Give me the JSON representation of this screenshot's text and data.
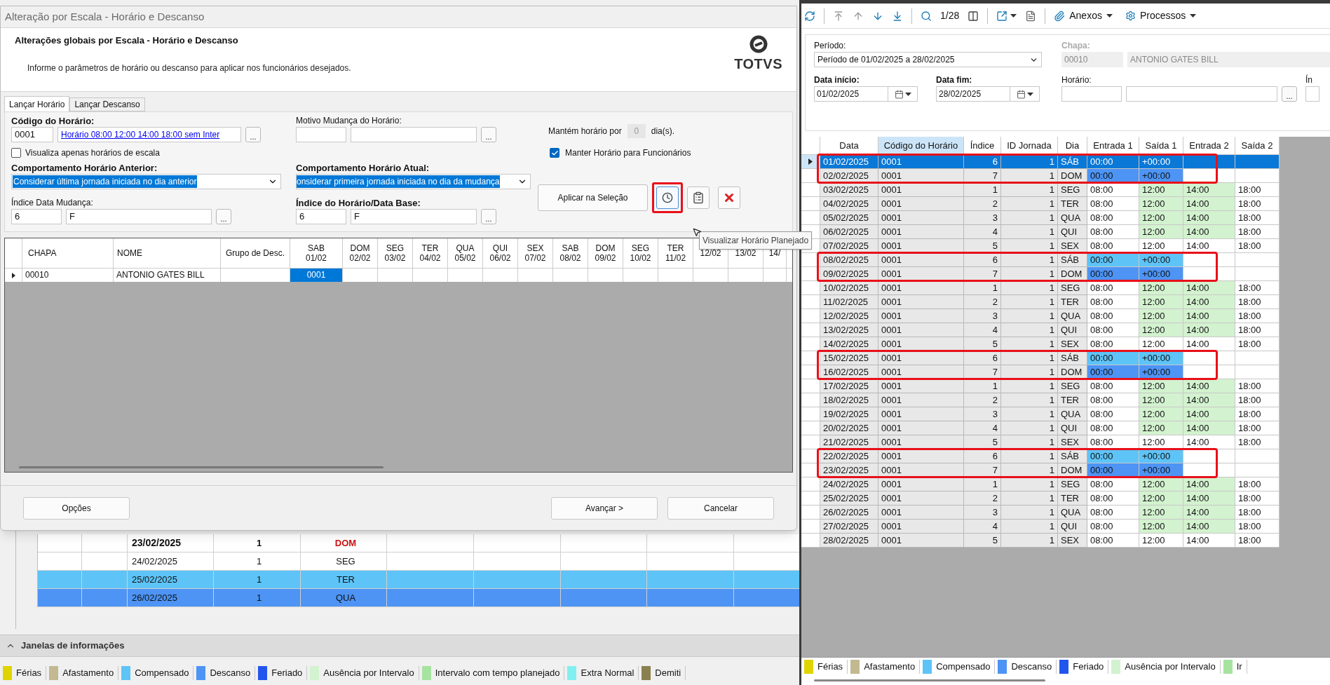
{
  "dialog": {
    "title": "Alteração por Escala - Horário e Descanso",
    "heading": "Alterações globais por Escala - Horário e Descanso",
    "description": "Informe o parâmetros de horário ou descanso para aplicar nos funcionários desejados.",
    "logo": "TOTVS",
    "tabs": [
      {
        "label": "Lançar Horário",
        "selected": true
      },
      {
        "label": "Lançar Descanso",
        "selected": false
      }
    ],
    "form": {
      "horario": {
        "label": "Código do Horário:",
        "code": "0001",
        "description": "Horário 08:00 12:00 14:00 18:00 sem Inter",
        "lookup": "..."
      },
      "only_scale": {
        "label": "Visualiza apenas horários de escala",
        "checked": false
      },
      "previous_behavior": {
        "label": "Comportamento Horário Anterior:",
        "value": "Considerar última jornada iniciada no dia anterior"
      },
      "change_index": {
        "label": "Índice Data Mudança:",
        "index": "6",
        "code": "F",
        "lookup": "..."
      },
      "reason": {
        "label": "Motivo Mudança do Horário:",
        "lookup": "..."
      },
      "current_behavior": {
        "label": "Comportamento Horário Atual:",
        "value": "onsiderar primeira jornada iniciada no dia da mudança"
      },
      "base_index": {
        "label": "Índice do Horário/Data Base:",
        "index": "6",
        "code": "F",
        "lookup": "..."
      },
      "keep_days": {
        "label": "Mantém horário por",
        "value": "0",
        "unit": "dia(s).",
        "disabled": true
      },
      "keep_schedule": {
        "label": "Manter Horário para Funcionários",
        "checked": true
      }
    },
    "actions": [
      {
        "kind": "text",
        "label": "Aplicar na Seleção"
      },
      {
        "kind": "clock",
        "highlighted": true
      },
      {
        "kind": "clipboard"
      },
      {
        "kind": "delete"
      }
    ],
    "tooltip": "Visualizar Horário Planejado",
    "grid": {
      "columns": [
        {
          "label": "CHAPA"
        },
        {
          "label": "NOME"
        },
        {
          "label": "Grupo de Desc."
        },
        {
          "day": "SAB",
          "date": "01/02"
        },
        {
          "day": "DOM",
          "date": "02/02"
        },
        {
          "day": "SEG",
          "date": "03/02"
        },
        {
          "day": "TER",
          "date": "04/02"
        },
        {
          "day": "QUA",
          "date": "05/02"
        },
        {
          "day": "QUI",
          "date": "06/02"
        },
        {
          "day": "SEX",
          "date": "07/02"
        },
        {
          "day": "SAB",
          "date": "08/02"
        },
        {
          "day": "DOM",
          "date": "09/02"
        },
        {
          "day": "SEG",
          "date": "10/02"
        },
        {
          "day": "TER",
          "date": "11/02"
        },
        {
          "date": "12/02"
        },
        {
          "date": "13/02"
        },
        {
          "date": "14/"
        }
      ],
      "rows": [
        {
          "chapa": "00010",
          "nome": "ANTONIO GATES BILL",
          "schedule": [
            {
              "value": "0001",
              "selected": true
            }
          ]
        }
      ]
    },
    "buttons": [
      "Opções",
      "Avançar >",
      "Cancelar"
    ]
  },
  "background_table": {
    "rows": [
      {
        "date": "23/02/2025",
        "jornada": "1",
        "day": "DOM",
        "sunday": true
      },
      {
        "date": "24/02/2025",
        "jornada": "1",
        "day": "SEG",
        "sunday": false
      },
      {
        "date": "25/02/2025",
        "jornada": "1",
        "day": "TER",
        "sunday": false,
        "color": "#5ec4f7"
      },
      {
        "date": "26/02/2025",
        "jornada": "1",
        "day": "QUA",
        "sunday": false,
        "color": "#4d94f5"
      }
    ]
  },
  "info_bar": {
    "title": "Janelas de informações"
  },
  "legend_left": [
    {
      "label": "Férias",
      "color": "#e0d400"
    },
    {
      "label": "Afastamento",
      "color": "#c2b990"
    },
    {
      "label": "Compensado",
      "color": "#5ec4f7"
    },
    {
      "label": "Descanso",
      "color": "#4d94f5"
    },
    {
      "label": "Feriado",
      "color": "#2255ee"
    },
    {
      "label": "Ausência por Intervalo",
      "color": "#d3f2cf"
    },
    {
      "label": "Intervalo com tempo planejado",
      "color": "#a6e3a0"
    },
    {
      "label": "Extra Normal",
      "color": "#80f0f0"
    },
    {
      "label": "Demiti",
      "color": "#8a8050"
    }
  ],
  "viewer": {
    "toolbar": {
      "counter": "1/28",
      "attachments": "Anexos",
      "processes": "Processos"
    },
    "period": {
      "label": "Período:",
      "value": "Período de 01/02/2025 a 28/02/2025"
    },
    "chapa": {
      "label": "Chapa:",
      "code": "00010",
      "name": "ANTONIO GATES BILL",
      "disabled": true
    },
    "start": {
      "label": "Data início:",
      "value": "01/02/2025"
    },
    "end": {
      "label": "Data fim:",
      "value": "28/02/2025"
    },
    "schedule": {
      "label": "Horário:",
      "lookup": "..."
    },
    "index_label": "Ín",
    "table": {
      "columns": [
        "Data",
        "Código do Horário",
        "Índice",
        "ID Jornada",
        "Dia",
        "Entrada 1",
        "Saída 1",
        "Entrada 2",
        "Saída 2"
      ],
      "rows": [
        {
          "date": "01/02/2025",
          "code": "0001",
          "index": "6",
          "jornada": "1",
          "day": "SÁB",
          "selected": true,
          "highlighted": true,
          "times": [
            {
              "value": "00:00"
            },
            {
              "value": "+00:00"
            }
          ]
        },
        {
          "date": "02/02/2025",
          "code": "0001",
          "index": "7",
          "jornada": "1",
          "day": "DOM",
          "selected": false,
          "highlighted": true,
          "times": [
            {
              "value": "00:00",
              "color": "#4d94f5"
            },
            {
              "value": "+00:00",
              "color": "#4d94f5"
            }
          ]
        },
        {
          "date": "03/02/2025",
          "code": "0001",
          "index": "1",
          "jornada": "1",
          "day": "SEG",
          "selected": false,
          "highlighted": false,
          "times": [
            {
              "value": "08:00"
            },
            {
              "value": "12:00",
              "color": "#d3f2cf"
            },
            {
              "value": "14:00",
              "color": "#d3f2cf"
            },
            {
              "value": "18:00"
            }
          ]
        },
        {
          "date": "04/02/2025",
          "code": "0001",
          "index": "2",
          "jornada": "1",
          "day": "TER",
          "selected": false,
          "highlighted": false,
          "times": [
            {
              "value": "08:00"
            },
            {
              "value": "12:00",
              "color": "#d3f2cf"
            },
            {
              "value": "14:00",
              "color": "#d3f2cf"
            },
            {
              "value": "18:00"
            }
          ]
        },
        {
          "date": "05/02/2025",
          "code": "0001",
          "index": "3",
          "jornada": "1",
          "day": "QUA",
          "selected": false,
          "highlighted": false,
          "times": [
            {
              "value": "08:00"
            },
            {
              "value": "12:00",
              "color": "#d3f2cf"
            },
            {
              "value": "14:00",
              "color": "#d3f2cf"
            },
            {
              "value": "18:00"
            }
          ]
        },
        {
          "date": "06/02/2025",
          "code": "0001",
          "index": "4",
          "jornada": "1",
          "day": "QUI",
          "selected": false,
          "highlighted": false,
          "times": [
            {
              "value": "08:00"
            },
            {
              "value": "12:00",
              "color": "#d3f2cf"
            },
            {
              "value": "14:00",
              "color": "#d3f2cf"
            },
            {
              "value": "18:00"
            }
          ]
        },
        {
          "date": "07/02/2025",
          "code": "0001",
          "index": "5",
          "jornada": "1",
          "day": "SEX",
          "selected": false,
          "highlighted": false,
          "times": [
            {
              "value": "08:00"
            },
            {
              "value": "12:00"
            },
            {
              "value": "14:00"
            },
            {
              "value": "18:00"
            }
          ]
        },
        {
          "date": "08/02/2025",
          "code": "0001",
          "index": "6",
          "jornada": "1",
          "day": "SÁB",
          "selected": false,
          "highlighted": true,
          "times": [
            {
              "value": "00:00",
              "color": "#5ec4f7"
            },
            {
              "value": "+00:00",
              "color": "#5ec4f7"
            }
          ]
        },
        {
          "date": "09/02/2025",
          "code": "0001",
          "index": "7",
          "jornada": "1",
          "day": "DOM",
          "selected": false,
          "highlighted": true,
          "times": [
            {
              "value": "00:00",
              "color": "#4d94f5"
            },
            {
              "value": "+00:00",
              "color": "#4d94f5"
            }
          ]
        },
        {
          "date": "10/02/2025",
          "code": "0001",
          "index": "1",
          "jornada": "1",
          "day": "SEG",
          "selected": false,
          "highlighted": false,
          "times": [
            {
              "value": "08:00"
            },
            {
              "value": "12:00",
              "color": "#d3f2cf"
            },
            {
              "value": "14:00",
              "color": "#d3f2cf"
            },
            {
              "value": "18:00"
            }
          ]
        },
        {
          "date": "11/02/2025",
          "code": "0001",
          "index": "2",
          "jornada": "1",
          "day": "TER",
          "selected": false,
          "highlighted": false,
          "times": [
            {
              "value": "08:00"
            },
            {
              "value": "12:00",
              "color": "#d3f2cf"
            },
            {
              "value": "14:00",
              "color": "#d3f2cf"
            },
            {
              "value": "18:00"
            }
          ]
        },
        {
          "date": "12/02/2025",
          "code": "0001",
          "index": "3",
          "jornada": "1",
          "day": "QUA",
          "selected": false,
          "highlighted": false,
          "times": [
            {
              "value": "08:00"
            },
            {
              "value": "12:00",
              "color": "#d3f2cf"
            },
            {
              "value": "14:00",
              "color": "#d3f2cf"
            },
            {
              "value": "18:00"
            }
          ]
        },
        {
          "date": "13/02/2025",
          "code": "0001",
          "index": "4",
          "jornada": "1",
          "day": "QUI",
          "selected": false,
          "highlighted": false,
          "times": [
            {
              "value": "08:00"
            },
            {
              "value": "12:00",
              "color": "#d3f2cf"
            },
            {
              "value": "14:00",
              "color": "#d3f2cf"
            },
            {
              "value": "18:00"
            }
          ]
        },
        {
          "date": "14/02/2025",
          "code": "0001",
          "index": "5",
          "jornada": "1",
          "day": "SEX",
          "selected": false,
          "highlighted": false,
          "times": [
            {
              "value": "08:00"
            },
            {
              "value": "12:00"
            },
            {
              "value": "14:00"
            },
            {
              "value": "18:00"
            }
          ]
        },
        {
          "date": "15/02/2025",
          "code": "0001",
          "index": "6",
          "jornada": "1",
          "day": "SÁB",
          "selected": false,
          "highlighted": true,
          "times": [
            {
              "value": "00:00",
              "color": "#5ec4f7"
            },
            {
              "value": "+00:00",
              "color": "#5ec4f7"
            }
          ]
        },
        {
          "date": "16/02/2025",
          "code": "0001",
          "index": "7",
          "jornada": "1",
          "day": "DOM",
          "selected": false,
          "highlighted": true,
          "times": [
            {
              "value": "00:00",
              "color": "#4d94f5"
            },
            {
              "value": "+00:00",
              "color": "#4d94f5"
            }
          ]
        },
        {
          "date": "17/02/2025",
          "code": "0001",
          "index": "1",
          "jornada": "1",
          "day": "SEG",
          "selected": false,
          "highlighted": false,
          "times": [
            {
              "value": "08:00"
            },
            {
              "value": "12:00",
              "color": "#d3f2cf"
            },
            {
              "value": "14:00",
              "color": "#d3f2cf"
            },
            {
              "value": "18:00"
            }
          ]
        },
        {
          "date": "18/02/2025",
          "code": "0001",
          "index": "2",
          "jornada": "1",
          "day": "TER",
          "selected": false,
          "highlighted": false,
          "times": [
            {
              "value": "08:00"
            },
            {
              "value": "12:00",
              "color": "#d3f2cf"
            },
            {
              "value": "14:00",
              "color": "#d3f2cf"
            },
            {
              "value": "18:00"
            }
          ]
        },
        {
          "date": "19/02/2025",
          "code": "0001",
          "index": "3",
          "jornada": "1",
          "day": "QUA",
          "selected": false,
          "highlighted": false,
          "times": [
            {
              "value": "08:00"
            },
            {
              "value": "12:00",
              "color": "#d3f2cf"
            },
            {
              "value": "14:00",
              "color": "#d3f2cf"
            },
            {
              "value": "18:00"
            }
          ]
        },
        {
          "date": "20/02/2025",
          "code": "0001",
          "index": "4",
          "jornada": "1",
          "day": "QUI",
          "selected": false,
          "highlighted": false,
          "times": [
            {
              "value": "08:00"
            },
            {
              "value": "12:00",
              "color": "#d3f2cf"
            },
            {
              "value": "14:00",
              "color": "#d3f2cf"
            },
            {
              "value": "18:00"
            }
          ]
        },
        {
          "date": "21/02/2025",
          "code": "0001",
          "index": "5",
          "jornada": "1",
          "day": "SEX",
          "selected": false,
          "highlighted": false,
          "times": [
            {
              "value": "08:00"
            },
            {
              "value": "12:00"
            },
            {
              "value": "14:00"
            },
            {
              "value": "18:00"
            }
          ]
        },
        {
          "date": "22/02/2025",
          "code": "0001",
          "index": "6",
          "jornada": "1",
          "day": "SÁB",
          "selected": false,
          "highlighted": true,
          "times": [
            {
              "value": "00:00",
              "color": "#5ec4f7"
            },
            {
              "value": "+00:00",
              "color": "#5ec4f7"
            }
          ]
        },
        {
          "date": "23/02/2025",
          "code": "0001",
          "index": "7",
          "jornada": "1",
          "day": "DOM",
          "selected": false,
          "highlighted": true,
          "times": [
            {
              "value": "00:00",
              "color": "#4d94f5"
            },
            {
              "value": "+00:00",
              "color": "#4d94f5"
            }
          ]
        },
        {
          "date": "24/02/2025",
          "code": "0001",
          "index": "1",
          "jornada": "1",
          "day": "SEG",
          "selected": false,
          "highlighted": false,
          "times": [
            {
              "value": "08:00"
            },
            {
              "value": "12:00",
              "color": "#d3f2cf"
            },
            {
              "value": "14:00",
              "color": "#d3f2cf"
            },
            {
              "value": "18:00"
            }
          ]
        },
        {
          "date": "25/02/2025",
          "code": "0001",
          "index": "2",
          "jornada": "1",
          "day": "TER",
          "selected": false,
          "highlighted": false,
          "times": [
            {
              "value": "08:00"
            },
            {
              "value": "12:00",
              "color": "#d3f2cf"
            },
            {
              "value": "14:00",
              "color": "#d3f2cf"
            },
            {
              "value": "18:00"
            }
          ]
        },
        {
          "date": "26/02/2025",
          "code": "0001",
          "index": "3",
          "jornada": "1",
          "day": "QUA",
          "selected": false,
          "highlighted": false,
          "times": [
            {
              "value": "08:00"
            },
            {
              "value": "12:00",
              "color": "#d3f2cf"
            },
            {
              "value": "14:00",
              "color": "#d3f2cf"
            },
            {
              "value": "18:00"
            }
          ]
        },
        {
          "date": "27/02/2025",
          "code": "0001",
          "index": "4",
          "jornada": "1",
          "day": "QUI",
          "selected": false,
          "highlighted": false,
          "times": [
            {
              "value": "08:00"
            },
            {
              "value": "12:00",
              "color": "#d3f2cf"
            },
            {
              "value": "14:00",
              "color": "#d3f2cf"
            },
            {
              "value": "18:00"
            }
          ]
        },
        {
          "date": "28/02/2025",
          "code": "0001",
          "index": "5",
          "jornada": "1",
          "day": "SEX",
          "selected": false,
          "highlighted": false,
          "times": [
            {
              "value": "08:00"
            },
            {
              "value": "12:00"
            },
            {
              "value": "14:00"
            },
            {
              "value": "18:00"
            }
          ]
        }
      ]
    },
    "legend": [
      {
        "label": "Férias",
        "color": "#e0d400"
      },
      {
        "label": "Afastamento",
        "color": "#c2b990"
      },
      {
        "label": "Compensado",
        "color": "#5ec4f7"
      },
      {
        "label": "Descanso",
        "color": "#4d94f5"
      },
      {
        "label": "Feriado",
        "color": "#2255ee"
      },
      {
        "label": "Ausência por Intervalo",
        "color": "#d3f2cf"
      },
      {
        "label": "Ir",
        "color": "#a6e3a0"
      }
    ]
  }
}
